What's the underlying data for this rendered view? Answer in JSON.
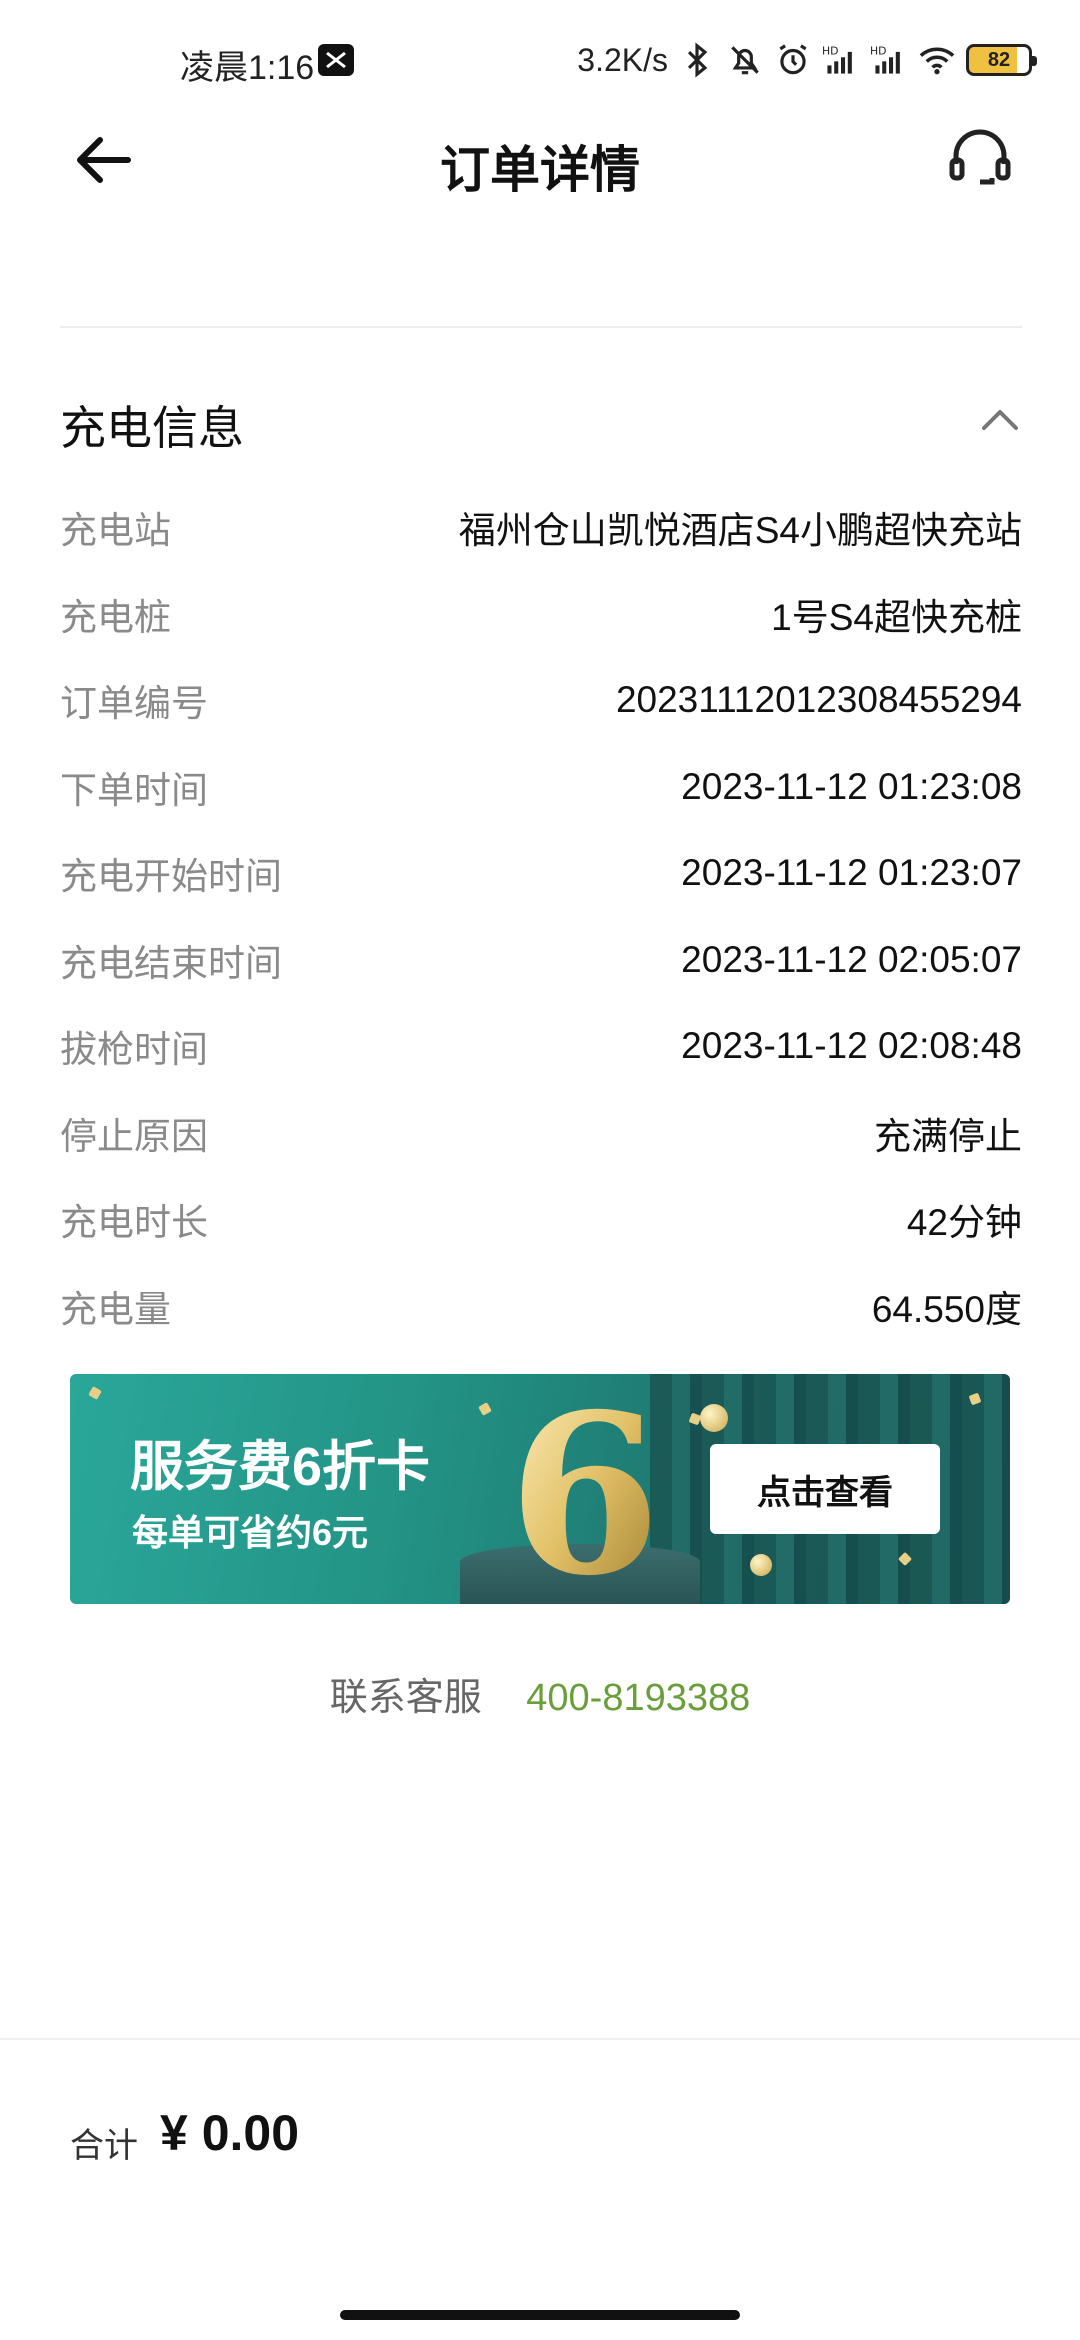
{
  "status_bar": {
    "time": "凌晨1:16",
    "net_speed": "3.2K/s",
    "battery": "82",
    "icons": [
      "message-icon",
      "bluetooth-icon",
      "mute-icon",
      "alarm-icon",
      "signal-hd-icon",
      "signal-hd-icon",
      "wifi-icon",
      "battery-icon"
    ]
  },
  "header": {
    "title": "订单详情",
    "back_icon": "arrow-left-icon",
    "support_icon": "headset-icon"
  },
  "section": {
    "title": "充电信息",
    "collapse_icon": "chevron-up-icon",
    "rows": [
      {
        "label": "充电站",
        "value": "福州仓山凯悦酒店S4小鹏超快充站"
      },
      {
        "label": "充电桩",
        "value": "1号S4超快充桩"
      },
      {
        "label": "订单编号",
        "value": "2023111201230845529 4"
      },
      {
        "label": "下单时间",
        "value": "2023-11-12 01:23:08"
      },
      {
        "label": "充电开始时间",
        "value": "2023-11-12 01:23:07"
      },
      {
        "label": "充电结束时间",
        "value": "2023-11-12 02:05:07"
      },
      {
        "label": "拔枪时间",
        "value": "2023-11-12 02:08:48"
      },
      {
        "label": "停止原因",
        "value": "充满停止"
      },
      {
        "label": "充电时长",
        "value": "42分钟"
      },
      {
        "label": "充电量",
        "value": "64.550度"
      }
    ]
  },
  "banner": {
    "title": "服务费6折卡",
    "subtitle": "每单可省约6元",
    "big_number": "6",
    "button": "点击查看"
  },
  "contact": {
    "label": "联系客服",
    "phone": "400-8193388"
  },
  "footer": {
    "total_label": "合计",
    "total_value": "¥ 0.00"
  }
}
